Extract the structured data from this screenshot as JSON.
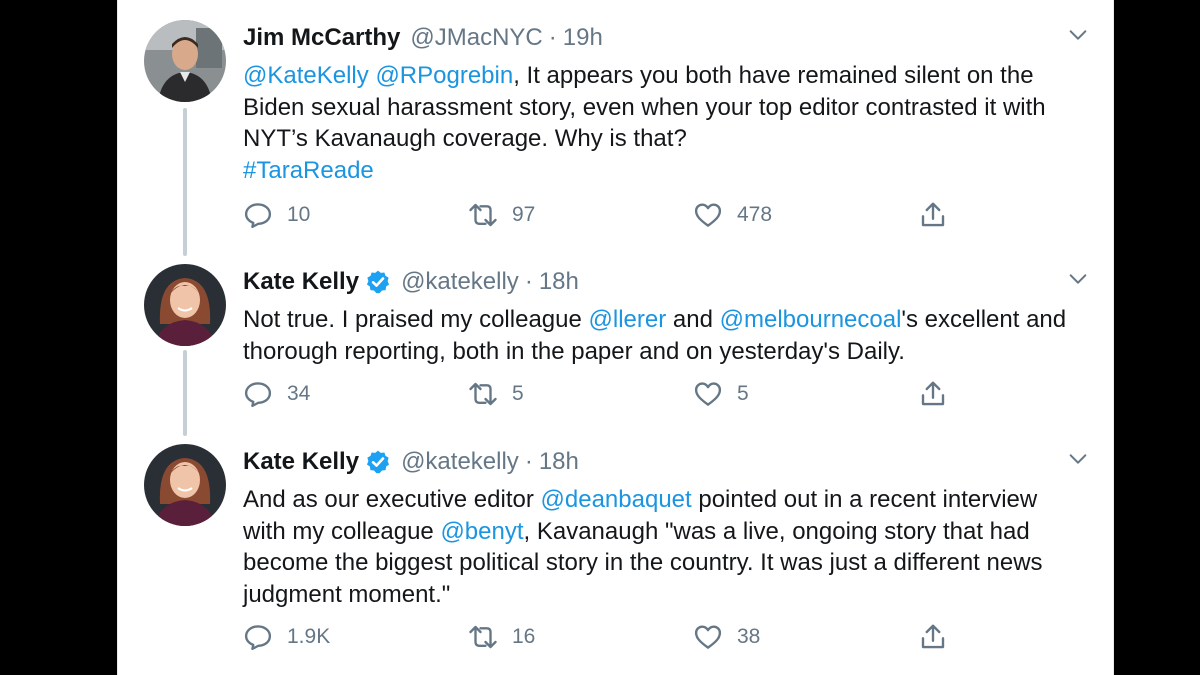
{
  "tweets": [
    {
      "name": "Jim McCarthy",
      "verified": false,
      "handle": "@JMacNYC",
      "separator": "·",
      "time": "19h",
      "body": [
        {
          "t": "@KateKelly",
          "link": true
        },
        {
          "t": " "
        },
        {
          "t": "@RPogrebin",
          "link": true
        },
        {
          "t": ", It appears you both have remained silent on the Biden sexual harassment story, even when your top editor contrasted it with NYT’s Kavanaugh coverage. Why is that?"
        },
        {
          "br": true
        },
        {
          "t": "#TaraReade",
          "link": true
        }
      ],
      "replies": "10",
      "retweets": "97",
      "likes": "478"
    },
    {
      "name": "Kate Kelly",
      "verified": true,
      "handle": "@katekelly",
      "separator": "·",
      "time": "18h",
      "body": [
        {
          "t": "Not true. I praised my colleague "
        },
        {
          "t": "@llerer",
          "link": true
        },
        {
          "t": " and "
        },
        {
          "t": "@melbournecoal",
          "link": true
        },
        {
          "t": "'s excellent and thorough reporting, both in the paper and on yesterday's Daily."
        }
      ],
      "replies": "34",
      "retweets": "5",
      "likes": "5"
    },
    {
      "name": "Kate Kelly",
      "verified": true,
      "handle": "@katekelly",
      "separator": "·",
      "time": "18h",
      "body": [
        {
          "t": "And as our executive editor "
        },
        {
          "t": "@deanbaquet",
          "link": true
        },
        {
          "t": " pointed out in a recent interview with my colleague "
        },
        {
          "t": "@benyt",
          "link": true
        },
        {
          "t": ", Kavanaugh \"was a live, ongoing story that had become the biggest political story in the country. It was just a different news judgment moment.\""
        }
      ],
      "replies": "1.9K",
      "retweets": "16",
      "likes": "38"
    }
  ],
  "colors": {
    "link": "#1b95e0",
    "secondary_text": "#657786",
    "primary_text": "#14171a",
    "verified_badge": "#1da1f2",
    "thread_line": "#c4cfd6"
  },
  "icons": [
    "reply-icon",
    "retweet-icon",
    "like-icon",
    "share-icon",
    "chevron-down-icon",
    "verified-badge-icon"
  ]
}
